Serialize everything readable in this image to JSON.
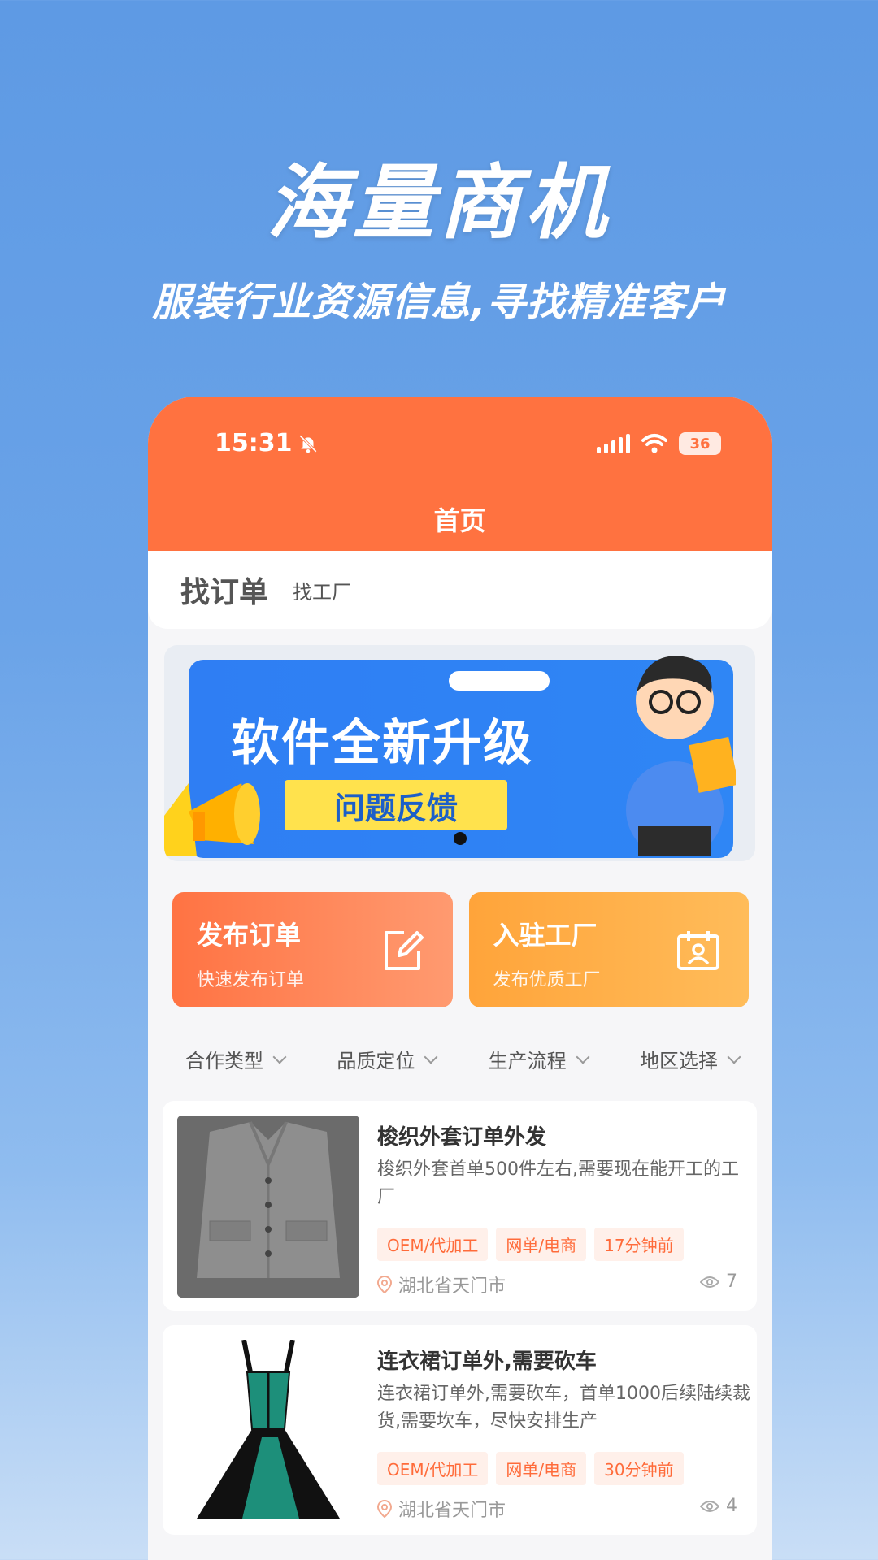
{
  "hero": {
    "title": "海量商机",
    "subtitle": "服装行业资源信息,寻找精准客户"
  },
  "status_bar": {
    "time": "15:31",
    "battery": "36"
  },
  "header": {
    "title": "首页"
  },
  "tabs": {
    "active": "找订单",
    "other": "找工厂"
  },
  "banner": {
    "headline": "软件全新升级",
    "button": "问题反馈"
  },
  "actions": [
    {
      "title": "发布订单",
      "subtitle": "快速发布订单",
      "icon": "edit-icon"
    },
    {
      "title": "入驻工厂",
      "subtitle": "发布优质工厂",
      "icon": "calendar-person-icon"
    }
  ],
  "filters": [
    "合作类型",
    "品质定位",
    "生产流程",
    "地区选择"
  ],
  "orders": [
    {
      "title": "梭织外套订单外发",
      "description": "梭织外套首单500件左右,需要现在能开工的工厂",
      "tags": [
        "OEM/代加工",
        "网单/电商",
        "17分钟前"
      ],
      "location": "湖北省天门市",
      "views": "7",
      "thumb": "jacket"
    },
    {
      "title": "连衣裙订单外,需要砍车",
      "description": "连衣裙订单外,需要砍车，首单1000后续陆续裁货,需要坎车，尽快安排生产",
      "tags": [
        "OEM/代加工",
        "网单/电商",
        "30分钟前"
      ],
      "location": "湖北省天门市",
      "views": "4",
      "thumb": "dress"
    }
  ],
  "colors": {
    "brand_orange": "#ff7240",
    "background_blue": "#5e9ae4",
    "tag_text": "#ff6b3a"
  }
}
